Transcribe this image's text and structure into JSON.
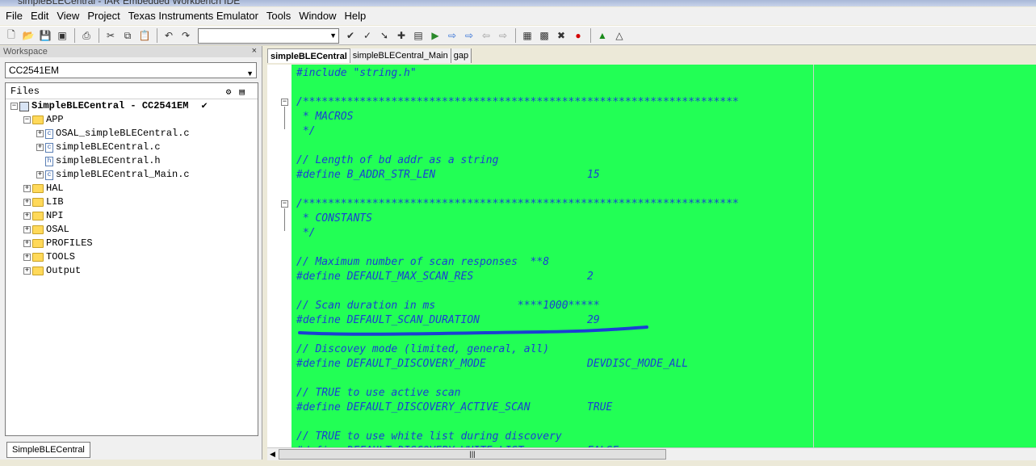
{
  "window": {
    "title": "simpleBLECentral - IAR Embedded Workbench IDE"
  },
  "menu": [
    "File",
    "Edit",
    "View",
    "Project",
    "Texas Instruments Emulator",
    "Tools",
    "Window",
    "Help"
  ],
  "toolbar": {
    "icons": [
      "new-file-icon",
      "open-icon",
      "save-icon",
      "save-all-icon",
      "print-icon",
      "cut-icon",
      "copy-icon",
      "paste-icon",
      "undo-icon",
      "redo-icon",
      "find-icon",
      "find-next-icon",
      "go-to-icon",
      "bookmark-icon",
      "navigate-back-icon",
      "navigate-forward-icon",
      "compile-icon",
      "make-icon",
      "stop-build-icon",
      "toggle-breakpoint-icon",
      "debug-icon",
      "debug-without-download-icon"
    ],
    "search_value": ""
  },
  "workspace": {
    "title": "Workspace",
    "close": "×",
    "config": "CC2541EM",
    "files_header": "Files",
    "tree": [
      {
        "label": "SimpleBLECentral - CC2541EM",
        "level": 0,
        "kind": "project",
        "expander": "−",
        "checked": "✔"
      },
      {
        "label": "APP",
        "level": 1,
        "kind": "folder",
        "expander": "−"
      },
      {
        "label": "OSAL_simpleBLECentral.c",
        "level": 2,
        "kind": "c",
        "expander": "+"
      },
      {
        "label": "simpleBLECentral.c",
        "level": 2,
        "kind": "c",
        "expander": "+"
      },
      {
        "label": "simpleBLECentral.h",
        "level": 2,
        "kind": "h",
        "expander": ""
      },
      {
        "label": "simpleBLECentral_Main.c",
        "level": 2,
        "kind": "c",
        "expander": "+"
      },
      {
        "label": "HAL",
        "level": 1,
        "kind": "folder",
        "expander": "+"
      },
      {
        "label": "LIB",
        "level": 1,
        "kind": "folder",
        "expander": "+"
      },
      {
        "label": "NPI",
        "level": 1,
        "kind": "folder",
        "expander": "+"
      },
      {
        "label": "OSAL",
        "level": 1,
        "kind": "folder",
        "expander": "+"
      },
      {
        "label": "PROFILES",
        "level": 1,
        "kind": "folder",
        "expander": "+"
      },
      {
        "label": "TOOLS",
        "level": 1,
        "kind": "folder",
        "expander": "+"
      },
      {
        "label": "Output",
        "level": 1,
        "kind": "folder",
        "expander": "+"
      }
    ],
    "bottom_tab": "SimpleBLECentral"
  },
  "editor": {
    "tabs": [
      "simpleBLECentral",
      "simpleBLECentral_Main",
      "gap"
    ],
    "active_tab": 0,
    "background": "#22ff55",
    "lines": [
      "#include \"string.h\"",
      "",
      "/*********************************************************************",
      " * MACROS",
      " */",
      "",
      "// Length of bd addr as a string",
      "#define B_ADDR_STR_LEN                        15",
      "",
      "/*********************************************************************",
      " * CONSTANTS",
      " */",
      "",
      "// Maximum number of scan responses  **8",
      "#define DEFAULT_MAX_SCAN_RES                  2",
      "",
      "// Scan duration in ms             ****1000*****",
      "#define DEFAULT_SCAN_DURATION                 29",
      "",
      "// Discovey mode (limited, general, all)",
      "#define DEFAULT_DISCOVERY_MODE                DEVDISC_MODE_ALL",
      "",
      "// TRUE to use active scan",
      "#define DEFAULT_DISCOVERY_ACTIVE_SCAN         TRUE",
      "",
      "// TRUE to use white list during discovery",
      "#define DEFAULT_DISCOVERY_WHITE_LIST          FALSE"
    ],
    "fold_markers": [
      "−",
      "−"
    ],
    "scroll_thumb": "|||"
  }
}
